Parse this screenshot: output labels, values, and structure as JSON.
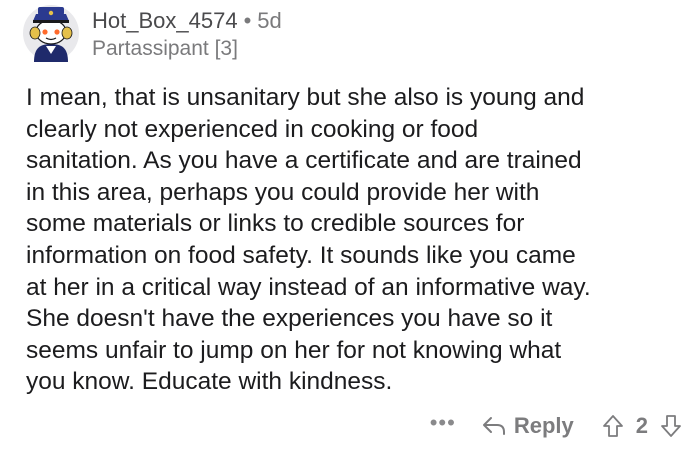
{
  "comment": {
    "username": "Hot_Box_4574",
    "separator": "•",
    "age": "5d",
    "flair": "Partassipant [3]",
    "body_lines": [
      "I mean, that is unsanitary but she also is young and",
      "clearly not experienced in cooking or food",
      "sanitation. As you have a certificate and are trained",
      "in this area, perhaps you could provide her with",
      "some materials or links to credible sources for",
      "information on food safety. It sounds like you came",
      "at her in a critical way instead of an informative way.",
      "She doesn't have the experiences you have so it",
      "seems unfair to jump on her for not knowing what",
      "you know. Educate with kindness."
    ],
    "actions": {
      "more_label": "•••",
      "reply_label": "Reply",
      "score": "2"
    }
  },
  "icons": {
    "avatar": "snoo-sailor-avatar",
    "more": "more-options-icon",
    "reply": "reply-arrow-icon",
    "upvote": "upvote-arrow-icon",
    "downvote": "downvote-arrow-icon"
  },
  "colors": {
    "text": "#1c1c1e",
    "meta": "#7a7a7c",
    "background": "#ffffff",
    "avatar_hat": "#2b3a8f",
    "avatar_accent": "#e5c04a"
  }
}
